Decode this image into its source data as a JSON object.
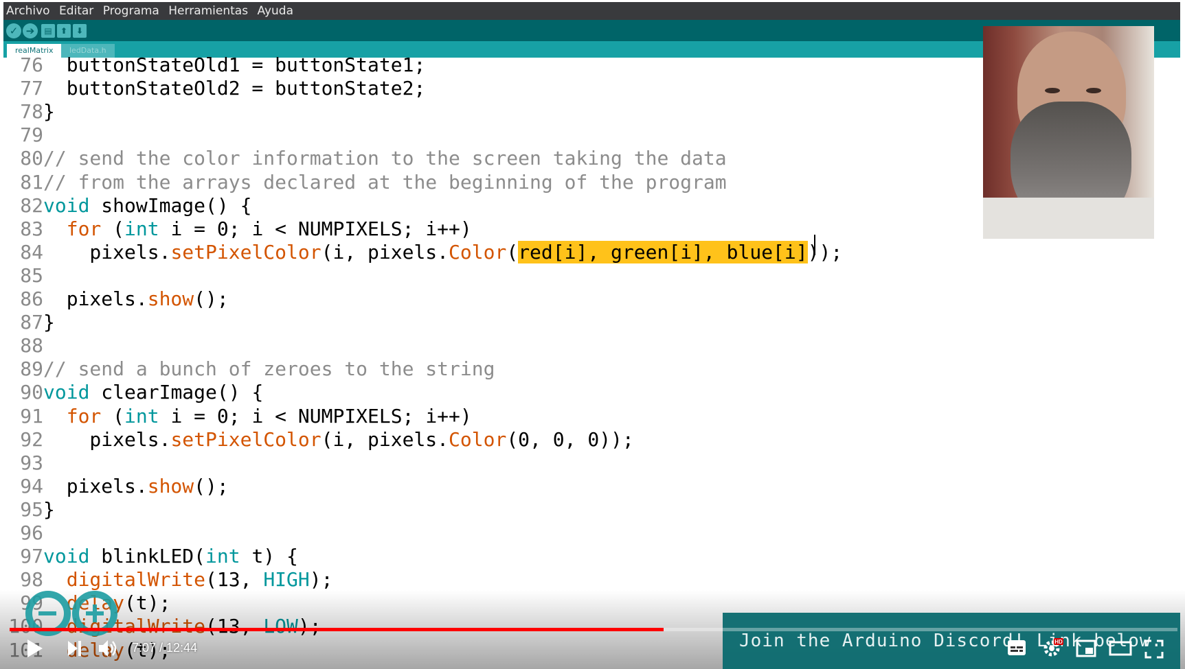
{
  "menu": [
    "Archivo",
    "Editar",
    "Programa",
    "Herramientas",
    "Ayuda"
  ],
  "toolbar": [
    {
      "icon": "verify-icon",
      "glyph": "✓"
    },
    {
      "icon": "upload-icon",
      "glyph": "➔"
    },
    {
      "icon": "new-icon",
      "glyph": "▤"
    },
    {
      "icon": "open-icon",
      "glyph": "⬆"
    },
    {
      "icon": "save-icon",
      "glyph": "⬇"
    }
  ],
  "tabs": [
    {
      "label": "realMatrix",
      "active": true
    },
    {
      "label": "ledData.h",
      "active": false
    }
  ],
  "code_lines": [
    {
      "n": "76",
      "tokens": [
        {
          "t": "  buttonStateOld1 = buttonState1;"
        }
      ]
    },
    {
      "n": "77",
      "tokens": [
        {
          "t": "  buttonStateOld2 = buttonState2;"
        }
      ]
    },
    {
      "n": "78",
      "tokens": [
        {
          "t": "}"
        }
      ]
    },
    {
      "n": "79",
      "tokens": []
    },
    {
      "n": "80",
      "tokens": [
        {
          "t": "// send the color information to the screen taking the data",
          "c": "cmt"
        }
      ]
    },
    {
      "n": "81",
      "tokens": [
        {
          "t": "// from the arrays declared at the beginning of the program",
          "c": "cmt"
        }
      ]
    },
    {
      "n": "82",
      "tokens": [
        {
          "t": "void",
          "c": "kw-type"
        },
        {
          "t": " showImage() {"
        }
      ]
    },
    {
      "n": "83",
      "tokens": [
        {
          "t": "  "
        },
        {
          "t": "for",
          "c": "kw-fn"
        },
        {
          "t": " ("
        },
        {
          "t": "int",
          "c": "kw-type"
        },
        {
          "t": " i = 0; i < NUMPIXELS; i++)"
        }
      ]
    },
    {
      "n": "84",
      "tokens": [
        {
          "t": "    pixels."
        },
        {
          "t": "setPixelColor",
          "c": "kw-fn"
        },
        {
          "t": "(i, pixels."
        },
        {
          "t": "Color",
          "c": "kw-fn"
        },
        {
          "t": "("
        },
        {
          "t": "red[i], green[i], blue[i]",
          "c": "hl"
        },
        {
          "t": "));"
        }
      ]
    },
    {
      "n": "85",
      "tokens": []
    },
    {
      "n": "86",
      "tokens": [
        {
          "t": "  pixels."
        },
        {
          "t": "show",
          "c": "kw-fn"
        },
        {
          "t": "();"
        }
      ]
    },
    {
      "n": "87",
      "tokens": [
        {
          "t": "}"
        }
      ]
    },
    {
      "n": "88",
      "tokens": []
    },
    {
      "n": "89",
      "tokens": [
        {
          "t": "// send a bunch of zeroes to the string",
          "c": "cmt"
        }
      ]
    },
    {
      "n": "90",
      "tokens": [
        {
          "t": "void",
          "c": "kw-type"
        },
        {
          "t": " clearImage() {"
        }
      ]
    },
    {
      "n": "91",
      "tokens": [
        {
          "t": "  "
        },
        {
          "t": "for",
          "c": "kw-fn"
        },
        {
          "t": " ("
        },
        {
          "t": "int",
          "c": "kw-type"
        },
        {
          "t": " i = 0; i < NUMPIXELS; i++)"
        }
      ]
    },
    {
      "n": "92",
      "tokens": [
        {
          "t": "    pixels."
        },
        {
          "t": "setPixelColor",
          "c": "kw-fn"
        },
        {
          "t": "(i, pixels."
        },
        {
          "t": "Color",
          "c": "kw-fn"
        },
        {
          "t": "(0, 0, 0));"
        }
      ]
    },
    {
      "n": "93",
      "tokens": []
    },
    {
      "n": "94",
      "tokens": [
        {
          "t": "  pixels."
        },
        {
          "t": "show",
          "c": "kw-fn"
        },
        {
          "t": "();"
        }
      ]
    },
    {
      "n": "95",
      "tokens": [
        {
          "t": "}"
        }
      ]
    },
    {
      "n": "96",
      "tokens": []
    },
    {
      "n": "97",
      "tokens": [
        {
          "t": "void",
          "c": "kw-type"
        },
        {
          "t": " blinkLED("
        },
        {
          "t": "int",
          "c": "kw-type"
        },
        {
          "t": " t) {"
        }
      ]
    },
    {
      "n": "98",
      "tokens": [
        {
          "t": "  "
        },
        {
          "t": "digitalWrite",
          "c": "kw-fn"
        },
        {
          "t": "(13, "
        },
        {
          "t": "HIGH",
          "c": "kw-const"
        },
        {
          "t": ");"
        }
      ]
    },
    {
      "n": "99",
      "tokens": [
        {
          "t": "  "
        },
        {
          "t": "delay",
          "c": "kw-fn"
        },
        {
          "t": "(t);"
        }
      ]
    },
    {
      "n": "100",
      "tokens": [
        {
          "t": "  "
        },
        {
          "t": "digitalWrite",
          "c": "kw-fn"
        },
        {
          "t": "(13, "
        },
        {
          "t": "LOW",
          "c": "kw-const"
        },
        {
          "t": ");"
        }
      ]
    },
    {
      "n": "101",
      "tokens": [
        {
          "t": "  "
        },
        {
          "t": "delay",
          "c": "kw-fn"
        },
        {
          "t": "(t);"
        }
      ]
    }
  ],
  "video": {
    "time": "7:07 / 12:44",
    "progress_fraction": 0.56,
    "banner_text": "Join the Arduino Discord! Link below.",
    "hd_badge": "HD"
  },
  "colors": {
    "menubar": "#393a3d",
    "toolbar": "#006468",
    "tabbar": "#17a1a5",
    "highlight": "#ffc21a",
    "progress": "#ff0000"
  }
}
